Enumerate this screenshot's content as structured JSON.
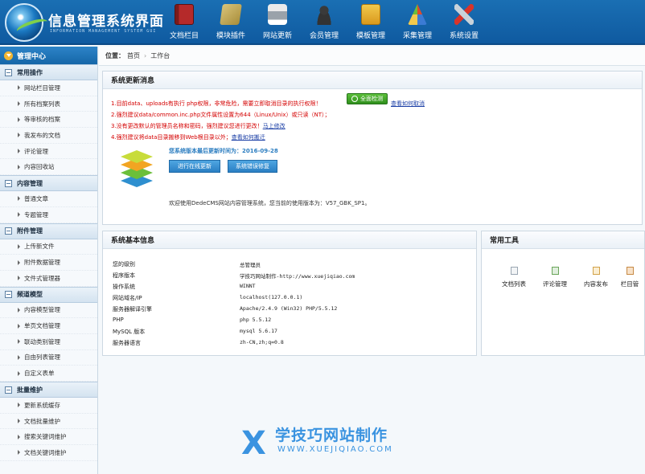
{
  "header": {
    "title": "信息管理系统界面",
    "subtitle": "INFORMATION MANAGEMENT SYSTEM GUI",
    "nav": [
      {
        "label": "文档栏目",
        "icon": "book-icon"
      },
      {
        "label": "模块插件",
        "icon": "plugin-icon"
      },
      {
        "label": "网站更新",
        "icon": "printer-icon"
      },
      {
        "label": "会员管理",
        "icon": "user-icon"
      },
      {
        "label": "模板管理",
        "icon": "folder-icon"
      },
      {
        "label": "采集管理",
        "icon": "collect-icon"
      },
      {
        "label": "系统设置",
        "icon": "tools-icon"
      }
    ]
  },
  "sidebar": {
    "center": "管理中心",
    "groups": [
      {
        "title": "常用操作",
        "items": [
          "网站栏目管理",
          "所有档案列表",
          "等审核的档案",
          "我发布的文档",
          "评论管理",
          "内容回收站"
        ]
      },
      {
        "title": "内容管理",
        "items": [
          "普通文章",
          "专题管理"
        ]
      },
      {
        "title": "附件管理",
        "items": [
          "上传新文件",
          "附件数据管理",
          "文件式管理器"
        ]
      },
      {
        "title": "频道模型",
        "items": [
          "内容模型管理",
          "单页文档管理",
          "联动类别管理",
          "自由列表管理",
          "自定义表单"
        ]
      },
      {
        "title": "批量维护",
        "items": [
          "更新系统缓存",
          "文档批量维护",
          "搜索关键词维护",
          "文档关键词维护"
        ]
      }
    ]
  },
  "breadcrumb": {
    "label": "位置：",
    "home": "首页",
    "current": "工作台"
  },
  "update_panel": {
    "title": "系统更新消息",
    "warnings": [
      {
        "text": "1.目前data、uploads有执行 php权限，非常危险，需要立即取消目录的执行权限！",
        "link": ""
      },
      {
        "text": "2.强烈建议data/common.inc.php文件属性设置为644（Linux/Unix）或只读（NT）；",
        "link": ""
      },
      {
        "text": "3.没有更改默认的管理员名称和密码，强烈建议您进行更改！",
        "link": "马上修改"
      },
      {
        "text": "4.强烈建议将data目录搬移到Web根目录以外；",
        "link": "查看如何搬迁"
      }
    ],
    "check_button": "全面检测",
    "fix_link": "查看如何取消",
    "last_update": "您系统版本最后更新时间为：2016-09-28",
    "online_update_button": "进行在线更新",
    "repair_button": "系统错误修复",
    "welcome": "欢迎使用DedeCMS网站内容管理系统，您当前的使用版本为：V57_GBK_SP1。"
  },
  "info_panel": {
    "title": "系统基本信息",
    "rows": [
      {
        "k": "您的级别",
        "v": "总管理员"
      },
      {
        "k": "程序版本",
        "v": "学技巧网站制作-http://www.xuejiqiao.com"
      },
      {
        "k": "操作系统",
        "v": "WINNT"
      },
      {
        "k": "网站域名/IP",
        "v": "localhost(127.0.0.1)"
      },
      {
        "k": "服务器解译引擎",
        "v": "Apache/2.4.9 (Win32) PHP/5.5.12"
      },
      {
        "k": "PHP",
        "v": "php 5.5.12"
      },
      {
        "k": "MySQL 版本",
        "v": "mysql 5.6.17"
      },
      {
        "k": "服务器语言",
        "v": "zh-CN,zh;q=0.8"
      }
    ]
  },
  "tools_panel": {
    "title": "常用工具",
    "tools": [
      "文档列表",
      "评论管理",
      "内容发布",
      "栏目管"
    ]
  },
  "watermark": {
    "mark": "X",
    "text": "学技巧网站制作",
    "url": "WWW.XUEJIQIAO.COM"
  }
}
